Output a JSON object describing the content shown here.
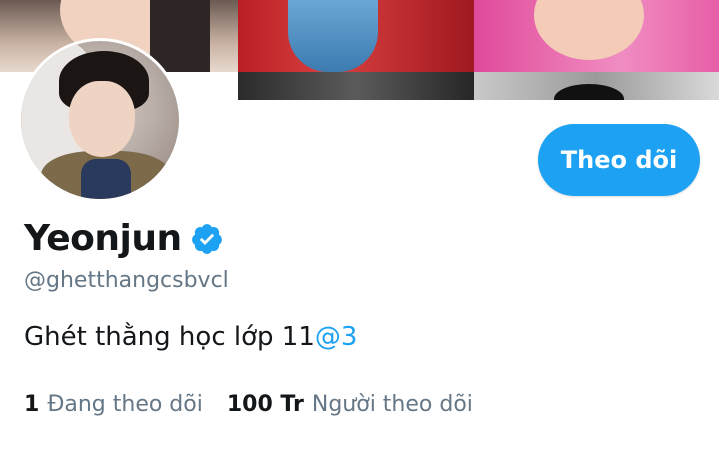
{
  "profile": {
    "display_name": "Yeonjun",
    "handle": "@ghetthangcsbvcl",
    "bio_text": "Ghét thằng học lớp 11",
    "bio_mention": "@3",
    "verified": true
  },
  "actions": {
    "follow_label": "Theo dõi"
  },
  "stats": {
    "following_count": "1",
    "following_label": "Đang theo dõi",
    "followers_count": "100 Tr",
    "followers_label": "Người theo dõi"
  },
  "colors": {
    "accent": "#1da1f2",
    "text_primary": "#14171a",
    "text_secondary": "#657786"
  },
  "icons": {
    "verified": "verified-badge-icon"
  }
}
